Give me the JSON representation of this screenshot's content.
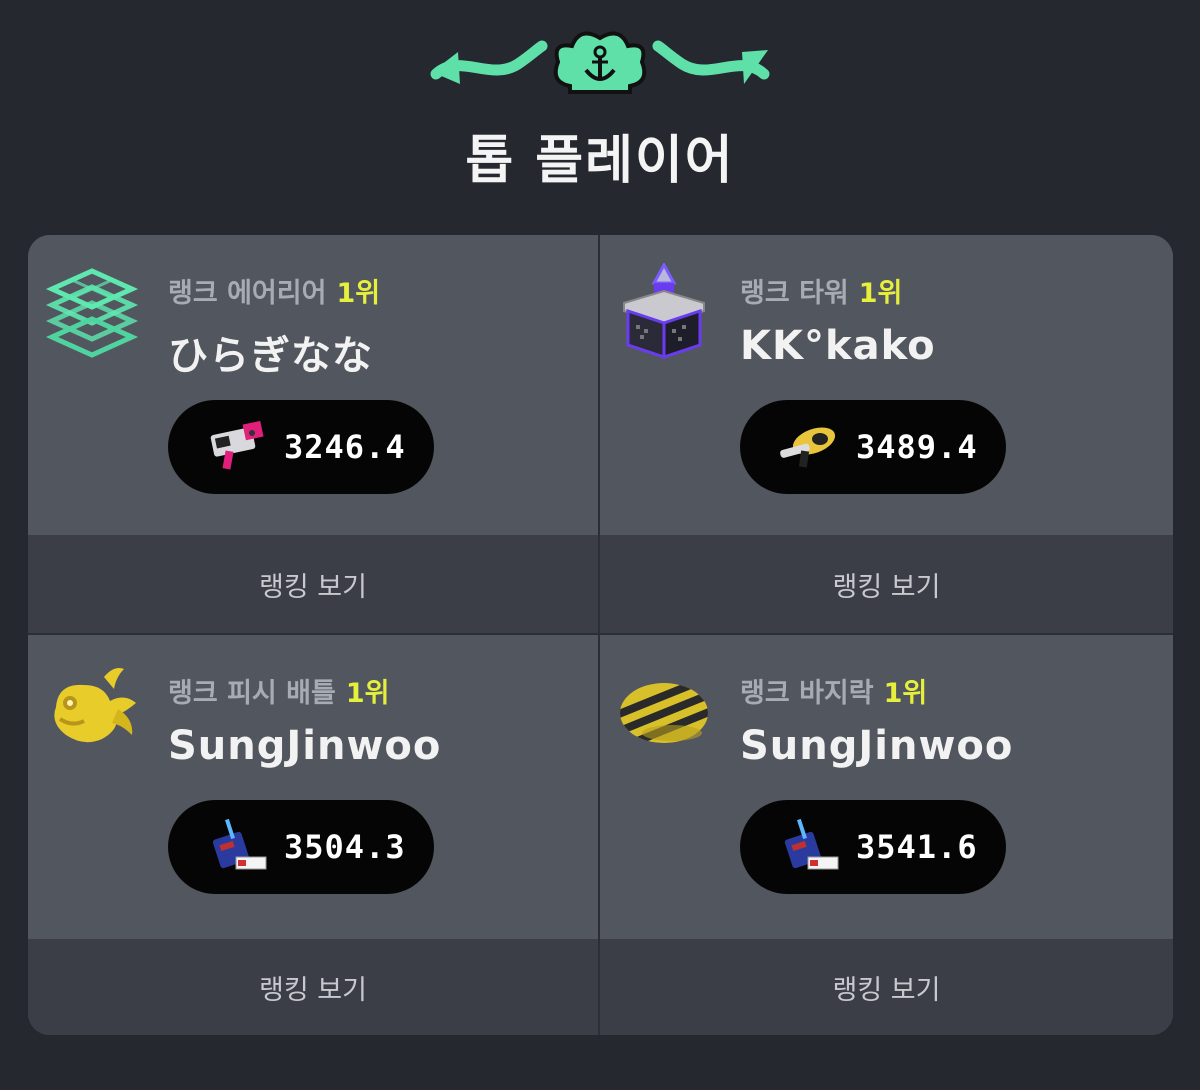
{
  "header": {
    "title": "톱 플레이어"
  },
  "cards": [
    {
      "mode": "랭크 에어리어",
      "rank": "1위",
      "player": "ひらぎなな",
      "power": "3246.4",
      "link": "랭킹 보기",
      "mode_icon": "splat-zones-icon",
      "weapon_icon": "pink-blaster-icon"
    },
    {
      "mode": "랭크 타워",
      "rank": "1위",
      "player": "KK°kako",
      "power": "3489.4",
      "link": "랭킹 보기",
      "mode_icon": "tower-control-icon",
      "weapon_icon": "yellow-gun-icon"
    },
    {
      "mode": "랭크 피시 배틀",
      "rank": "1위",
      "player": "SungJinwoo",
      "power": "3504.3",
      "link": "랭킹 보기",
      "mode_icon": "golden-fish-icon",
      "weapon_icon": "blue-bag-weapon-icon"
    },
    {
      "mode": "랭크 바지락",
      "rank": "1위",
      "player": "SungJinwoo",
      "power": "3541.6",
      "link": "랭킹 보기",
      "mode_icon": "striped-clam-icon",
      "weapon_icon": "blue-bag-weapon-icon"
    }
  ],
  "colors": {
    "accent": "#5fe0a8",
    "rank": "#e6ef3c",
    "background": "#262830",
    "card": "#52575f",
    "footer": "#3b3e46"
  }
}
